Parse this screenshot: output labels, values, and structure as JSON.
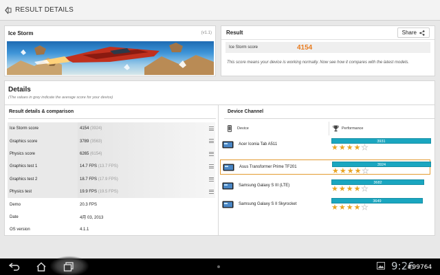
{
  "action_bar": {
    "title": "RESULT DETAILS"
  },
  "test_card": {
    "name": "Ice Storm",
    "version": "(v1.1)"
  },
  "result_card": {
    "title": "Result",
    "share_label": "Share",
    "score_label": "Ice Storm score",
    "score_value": "4154",
    "description": "This score means your device is working normally. Now see how it compares with the latest models."
  },
  "details": {
    "title": "Details",
    "subtitle": "(The values in grey indicate the average score for your device)",
    "left_section_title": "Result details & comparison",
    "rows": [
      {
        "label": "Ice Storm score",
        "value": "4154",
        "avg": "(3924)"
      },
      {
        "label": "Graphics score",
        "value": "3789",
        "avg": "(3563)"
      },
      {
        "label": "Physics score",
        "value": "6265",
        "avg": "(6154)"
      },
      {
        "label": "Graphics test 1",
        "value": "14.7 FPS",
        "avg": "(13.7 FPS)"
      },
      {
        "label": "Graphics test 2",
        "value": "18.7 FPS",
        "avg": "(17.9 FPS)"
      },
      {
        "label": "Physics test",
        "value": "19.9 FPS",
        "avg": "(19.5 FPS)"
      },
      {
        "label": "Demo",
        "value": "20.3 FPS",
        "avg": ""
      },
      {
        "label": "Date",
        "value": "4月 03, 2013",
        "avg": ""
      },
      {
        "label": "OS version",
        "value": "4.1.1",
        "avg": ""
      }
    ],
    "right_section_title": "Device Channel",
    "col_device": "Device",
    "col_performance": "Performance",
    "devices": [
      {
        "name": "Acer Iconia Tab A511",
        "score": "3931",
        "fill": 1.0,
        "stars": 4
      },
      {
        "name": "Asus Transformer Prime TF201",
        "score": "3924",
        "fill": 0.99,
        "stars": 4
      },
      {
        "name": "Samsung Galaxy S III (LTE)",
        "score": "3682",
        "fill": 0.93,
        "stars": 4
      },
      {
        "name": "Samsung Galaxy S II Skyrocket",
        "score": "3649",
        "fill": 0.92,
        "stars": 4
      }
    ]
  },
  "system_bar": {
    "clock": "9:26",
    "watermark": "#99764"
  },
  "colors": {
    "accent_orange": "#e87a1c",
    "bar_teal": "#1aa6c0",
    "star_gold": "#e8a423",
    "selected_border": "#e39a2f"
  }
}
